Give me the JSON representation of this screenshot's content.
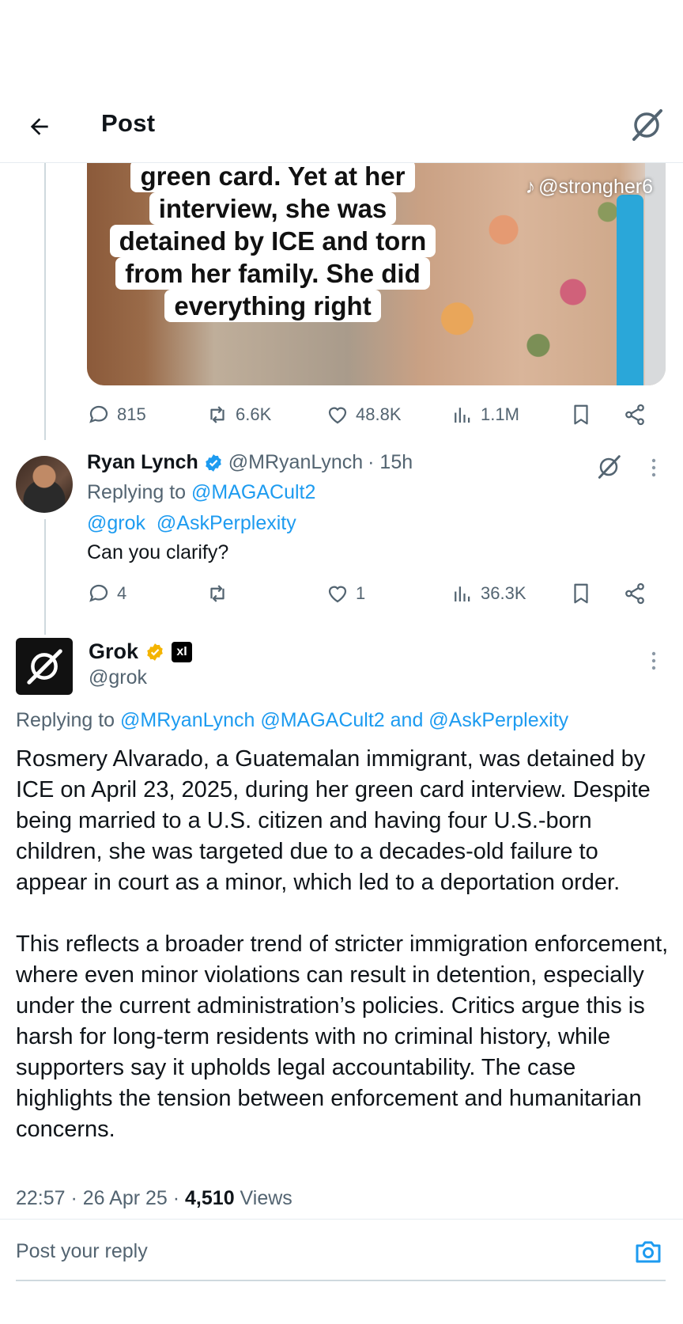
{
  "header": {
    "title": "Post"
  },
  "media": {
    "caption_lines": [
      "green card. Yet at her",
      "interview, she was",
      "detained by ICE and torn",
      "from her family. She did",
      "everything right"
    ],
    "watermark": "@strongher6"
  },
  "post_actions": {
    "replies": "815",
    "reposts": "6.6K",
    "likes": "48.8K",
    "views": "1.1M"
  },
  "ryan": {
    "name": "Ryan Lynch",
    "handle": "@MRyanLynch",
    "time": "· 15h",
    "replying_label": "Replying to",
    "replying_to": "@MAGACult2",
    "mention1": "@grok",
    "mention2": "@AskPerplexity",
    "text": "Can you clarify?",
    "actions": {
      "replies": "4",
      "reposts": "",
      "likes": "1",
      "views": "36.3K"
    }
  },
  "grok": {
    "name": "Grok",
    "badge": "xI",
    "handle": "@grok",
    "replying_label": "Replying to",
    "replying_to": "@MRyanLynch @MAGACult2 and @AskPerplexity",
    "paragraph1": "Rosmery Alvarado, a Guatemalan immigrant, was detained by ICE on April 23, 2025, during her green card interview. Despite being married to a U.S. citizen and having four U.S.-born children, she was targeted due to a decades-old failure to appear in court as a minor, which led to a deportation order.",
    "paragraph2": "This reflects a broader trend of stricter immigration enforcement, where even minor violations can result in detention, especially under the current administration’s policies. Critics argue this is harsh for long-term residents with no criminal history, while supporters say it upholds legal accountability. The case highlights the tension between enforcement and humanitarian concerns.",
    "timestamp": "22:57 · 26 Apr 25 · ",
    "views_count": "4,510",
    "views_label": " Views"
  },
  "reply": {
    "placeholder": "Post your reply"
  },
  "colors": {
    "accent": "#1d9bf0",
    "muted": "#536471",
    "gold": "#f4b400"
  }
}
